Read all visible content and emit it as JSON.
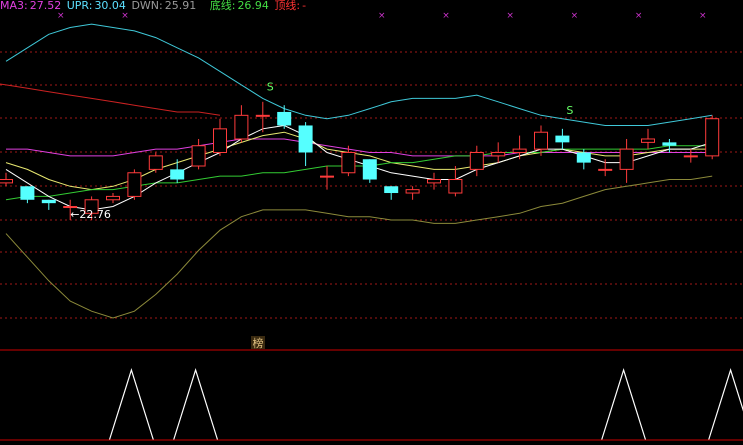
{
  "legend": {
    "ma3_label": "MA3:",
    "ma3_value": "27.52",
    "upr_label": "UPR:",
    "upr_value": "30.04",
    "dwn_label": "DWN:",
    "dwn_value": "25.91",
    "bottom_label": "底线:",
    "bottom_value": "26.94",
    "top_label": "顶线:",
    "top_value": "-"
  },
  "colors": {
    "background": "#000000",
    "up_candle": "#ff3b3b",
    "down_candle": "#55ffff",
    "upr": "#3fc8d8",
    "dwn": "#8c8a3a",
    "bottom_line": "#33cc33",
    "top_line": "#cc2222",
    "ma_white": "#ffffff",
    "ma_yellow": "#e8e870",
    "ma_magenta": "#e040e0",
    "marker_x": "#cc33cc",
    "panel_separator": "#cc0000",
    "grid": "#a01818",
    "indicator": "#ffffff"
  },
  "chart_data": {
    "type": "candlestick",
    "y_range": [
      22.0,
      31.0
    ],
    "x_count": 34,
    "candles": [
      {
        "o": 26.0,
        "c": 26.1,
        "h": 26.3,
        "l": 25.9
      },
      {
        "o": 25.9,
        "c": 25.5,
        "h": 25.9,
        "l": 25.4
      },
      {
        "o": 25.5,
        "c": 25.4,
        "h": 25.5,
        "l": 25.2
      },
      {
        "o": 25.3,
        "c": 25.3,
        "h": 25.5,
        "l": 24.9
      },
      {
        "o": 25.1,
        "c": 25.5,
        "h": 25.6,
        "l": 24.9
      },
      {
        "o": 25.5,
        "c": 25.6,
        "h": 25.7,
        "l": 25.4
      },
      {
        "o": 25.6,
        "c": 26.3,
        "h": 26.4,
        "l": 25.5
      },
      {
        "o": 26.4,
        "c": 26.8,
        "h": 26.9,
        "l": 26.3
      },
      {
        "o": 26.4,
        "c": 26.1,
        "h": 26.7,
        "l": 26.0
      },
      {
        "o": 26.5,
        "c": 27.1,
        "h": 27.3,
        "l": 26.4
      },
      {
        "o": 26.9,
        "c": 27.6,
        "h": 27.9,
        "l": 26.8
      },
      {
        "o": 27.3,
        "c": 28.0,
        "h": 28.3,
        "l": 27.2
      },
      {
        "o": 28.0,
        "c": 28.0,
        "h": 28.4,
        "l": 27.5
      },
      {
        "o": 28.1,
        "c": 27.7,
        "h": 28.3,
        "l": 27.6
      },
      {
        "o": 27.7,
        "c": 26.9,
        "h": 27.8,
        "l": 26.5
      },
      {
        "o": 26.2,
        "c": 26.2,
        "h": 26.5,
        "l": 25.8
      },
      {
        "o": 26.3,
        "c": 26.9,
        "h": 27.1,
        "l": 26.2
      },
      {
        "o": 26.7,
        "c": 26.1,
        "h": 26.7,
        "l": 26.0
      },
      {
        "o": 25.9,
        "c": 25.7,
        "h": 25.9,
        "l": 25.5
      },
      {
        "o": 25.7,
        "c": 25.8,
        "h": 25.9,
        "l": 25.5
      },
      {
        "o": 26.0,
        "c": 26.1,
        "h": 26.3,
        "l": 25.8
      },
      {
        "o": 25.7,
        "c": 26.1,
        "h": 26.5,
        "l": 25.6
      },
      {
        "o": 26.4,
        "c": 26.9,
        "h": 27.1,
        "l": 26.2
      },
      {
        "o": 26.8,
        "c": 26.9,
        "h": 27.2,
        "l": 26.6
      },
      {
        "o": 26.9,
        "c": 27.0,
        "h": 27.4,
        "l": 26.7
      },
      {
        "o": 27.0,
        "c": 27.5,
        "h": 27.7,
        "l": 26.8
      },
      {
        "o": 27.4,
        "c": 27.2,
        "h": 27.6,
        "l": 27.0
      },
      {
        "o": 26.9,
        "c": 26.6,
        "h": 27.0,
        "l": 26.4
      },
      {
        "o": 26.4,
        "c": 26.4,
        "h": 26.7,
        "l": 26.2
      },
      {
        "o": 26.4,
        "c": 27.0,
        "h": 27.3,
        "l": 26.0
      },
      {
        "o": 27.2,
        "c": 27.3,
        "h": 27.6,
        "l": 27.0
      },
      {
        "o": 27.2,
        "c": 27.1,
        "h": 27.3,
        "l": 26.9
      },
      {
        "o": 26.8,
        "c": 26.8,
        "h": 27.0,
        "l": 26.6
      },
      {
        "o": 26.8,
        "c": 27.9,
        "h": 28.0,
        "l": 26.7
      }
    ],
    "lines": {
      "upr": [
        29.6,
        30.0,
        30.4,
        30.6,
        30.7,
        30.6,
        30.5,
        30.3,
        30.0,
        29.7,
        29.3,
        28.9,
        28.5,
        28.2,
        28.0,
        27.9,
        28.0,
        28.2,
        28.4,
        28.5,
        28.5,
        28.5,
        28.6,
        28.4,
        28.2,
        28.0,
        27.9,
        27.8,
        27.7,
        27.7,
        27.7,
        27.8,
        27.9,
        28.0
      ],
      "dwn": [
        24.5,
        23.8,
        23.1,
        22.5,
        22.2,
        22.0,
        22.2,
        22.7,
        23.3,
        24.0,
        24.6,
        25.0,
        25.2,
        25.2,
        25.2,
        25.1,
        25.0,
        25.0,
        24.9,
        24.9,
        24.8,
        24.8,
        24.9,
        25.0,
        25.1,
        25.3,
        25.4,
        25.6,
        25.8,
        25.9,
        26.0,
        26.1,
        26.1,
        26.2
      ],
      "bottom_line": [
        25.5,
        25.6,
        25.6,
        25.7,
        25.8,
        25.8,
        25.9,
        26.0,
        26.0,
        26.1,
        26.2,
        26.2,
        26.3,
        26.3,
        26.4,
        26.5,
        26.5,
        26.5,
        26.6,
        26.6,
        26.7,
        26.8,
        26.8,
        26.9,
        26.9,
        26.9,
        27.0,
        27.0,
        27.0,
        27.0,
        27.0,
        27.1,
        27.1,
        27.1
      ],
      "top_line": [
        29.0,
        28.9,
        28.8,
        28.7,
        28.6,
        28.5,
        28.4,
        28.3,
        28.2,
        28.1,
        28.1,
        28.0
      ],
      "ma_white": [
        26.4,
        26.0,
        25.6,
        25.3,
        25.2,
        25.3,
        25.6,
        26.0,
        26.3,
        26.6,
        26.9,
        27.3,
        27.6,
        27.7,
        27.4,
        26.9,
        26.7,
        26.5,
        26.3,
        26.2,
        26.1,
        26.1,
        26.4,
        26.6,
        26.8,
        27.0,
        27.0,
        26.8,
        26.6,
        26.6,
        26.8,
        27.0,
        27.0,
        27.2
      ],
      "ma_yellow": [
        26.6,
        26.4,
        26.1,
        25.9,
        25.8,
        25.9,
        26.1,
        26.4,
        26.6,
        26.8,
        27.0,
        27.2,
        27.4,
        27.5,
        27.3,
        27.0,
        26.9,
        26.8,
        26.6,
        26.5,
        26.4,
        26.4,
        26.5,
        26.6,
        26.8,
        26.9,
        27.0,
        26.9,
        26.8,
        26.8,
        26.9,
        27.0,
        27.0,
        27.0
      ],
      "ma_magenta": [
        27.0,
        27.0,
        26.9,
        26.8,
        26.8,
        26.8,
        26.9,
        27.0,
        27.0,
        27.1,
        27.2,
        27.3,
        27.3,
        27.3,
        27.2,
        27.1,
        27.0,
        26.9,
        26.9,
        26.8,
        26.8,
        26.8,
        26.8,
        26.8,
        26.9,
        26.9,
        26.9,
        26.9,
        26.9,
        26.9,
        26.9,
        26.9,
        26.9,
        26.9
      ]
    },
    "annotations": [
      {
        "text": "←22.76",
        "index": 3,
        "value": 25.25
      },
      {
        "text": "S",
        "index": 12,
        "value": 28.5
      },
      {
        "text": "S",
        "index": 26,
        "value": 27.8
      }
    ],
    "top_markers_x": [
      2,
      5,
      17,
      20,
      23,
      26,
      29,
      32
    ],
    "bottom_panel_label": "榜",
    "indicator_peaks": [
      6,
      9,
      29,
      34
    ]
  }
}
